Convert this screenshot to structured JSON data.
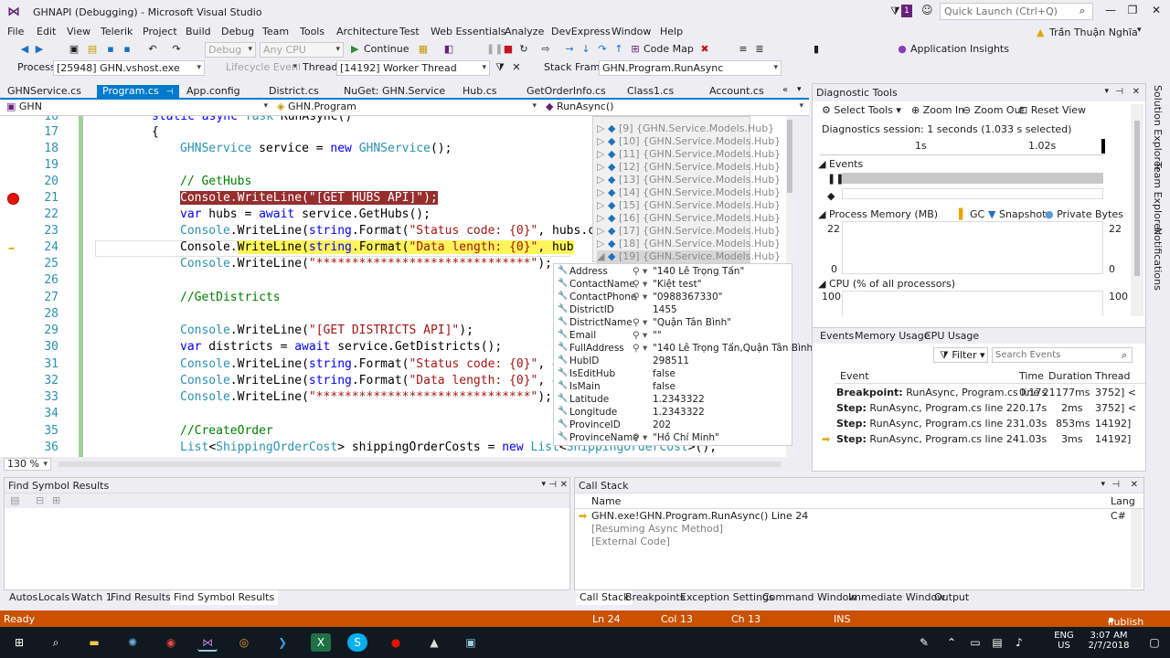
{
  "window": {
    "title": "GHNAPI (Debugging) - Microsoft Visual Studio",
    "quick_launch_placeholder": "Quick Launch (Ctrl+Q)",
    "notification_count": "1"
  },
  "menu": [
    "File",
    "Edit",
    "View",
    "Telerik",
    "Project",
    "Build",
    "Debug",
    "Team",
    "Tools",
    "Architecture",
    "Test",
    "Web Essentials",
    "Analyze",
    "DevExpress",
    "Window",
    "Help"
  ],
  "user": "Trần Thuận Nghĩa",
  "toolbar": {
    "config": "Debug",
    "platform": "Any CPU",
    "continue": "Continue",
    "code_map": "Code Map",
    "app_insights": "Application Insights"
  },
  "debug_location": {
    "process_label": "Process:",
    "process": "[25948] GHN.vshost.exe",
    "lifecycle": "Lifecycle Events",
    "thread_label": "Thread:",
    "thread": "[14192] Worker Thread",
    "frame_label": "Stack Frame:",
    "frame": "GHN.Program.RunAsync"
  },
  "doc_tabs": [
    "GHNService.cs",
    "Program.cs",
    "App.config",
    "District.cs",
    "NuGet: GHN.Service",
    "Hub.cs",
    "GetOrderInfo.cs",
    "Class1.cs",
    "Account.cs"
  ],
  "nav": {
    "project": "GHN",
    "class": "GHN.Program",
    "member": "RunAsync()"
  },
  "code_lines": [
    {
      "n": "16",
      "text": "static async Task RunAsync()"
    },
    {
      "n": "17",
      "text": "{"
    },
    {
      "n": "18",
      "text": "GHNService service = new GHNService();"
    },
    {
      "n": "19",
      "text": ""
    },
    {
      "n": "20",
      "text": "// GetHubs"
    },
    {
      "n": "21",
      "text": "Console.WriteLine(\"[GET HUBS API]\");"
    },
    {
      "n": "22",
      "text": "var hubs = await service.GetHubs();"
    },
    {
      "n": "23",
      "text": "Console.WriteLine(string.Format(\"Status code: {0}\", hubs.c"
    },
    {
      "n": "24",
      "text": "Console.WriteLine(string.Format(\"Data length: {0}\", hub"
    },
    {
      "n": "25",
      "text": "Console.WriteLine(\"******************************\");"
    },
    {
      "n": "26",
      "text": ""
    },
    {
      "n": "27",
      "text": "//GetDistricts"
    },
    {
      "n": "28",
      "text": ""
    },
    {
      "n": "29",
      "text": "Console.WriteLine(\"[GET DISTRICTS API]\");"
    },
    {
      "n": "30",
      "text": "var districts = await service.GetDistricts();"
    },
    {
      "n": "31",
      "text": "Console.WriteLine(string.Format(\"Status code: {0}\", d"
    },
    {
      "n": "32",
      "text": "Console.WriteLine(string.Format(\"Data length: {0}\", d"
    },
    {
      "n": "33",
      "text": "Console.WriteLine(\"******************************\");"
    },
    {
      "n": "34",
      "text": ""
    },
    {
      "n": "35",
      "text": "//CreateOrder"
    },
    {
      "n": "36",
      "text": "List<ShippingOrderCost> shippingOrderCosts = new List<ShippingOrderCost>();"
    }
  ],
  "hub_items": [
    "[9]",
    "[10]",
    "[11]",
    "[12]",
    "[13]",
    "[14]",
    "[15]",
    "[16]",
    "[17]",
    "[18]",
    "[19]"
  ],
  "hub_type": "{GHN.Service.Models.Hub}",
  "hub_props": [
    {
      "name": "Address",
      "value": "\"140 Lê Trọng Tấn\"",
      "str": true
    },
    {
      "name": "ContactName",
      "value": "\"Kiệt test\"",
      "str": true
    },
    {
      "name": "ContactPhone",
      "value": "\"0988367330\"",
      "str": true
    },
    {
      "name": "DistrictID",
      "value": "1455",
      "str": false
    },
    {
      "name": "DistrictName",
      "value": "\"Quận Tân Bình\"",
      "str": true
    },
    {
      "name": "Email",
      "value": "\"\"",
      "str": true
    },
    {
      "name": "FullAddress",
      "value": "\"140 Lê Trọng Tấn,Quận Tân Bình\"",
      "str": true
    },
    {
      "name": "HubID",
      "value": "298511",
      "str": false
    },
    {
      "name": "IsEditHub",
      "value": "false",
      "str": false
    },
    {
      "name": "IsMain",
      "value": "false",
      "str": false
    },
    {
      "name": "Latitude",
      "value": "1.2343322",
      "str": false
    },
    {
      "name": "Longitude",
      "value": "1.2343322",
      "str": false
    },
    {
      "name": "ProvinceID",
      "value": "202",
      "str": false
    },
    {
      "name": "ProvinceName",
      "value": "\"Hồ Chí Minh\"",
      "str": true
    }
  ],
  "zoom": "130 %",
  "diag": {
    "title": "Diagnostic Tools",
    "select_tools": "Select Tools",
    "zoom_in": "Zoom In",
    "zoom_out": "Zoom Out",
    "reset_view": "Reset View",
    "session": "Diagnostics session: 1 seconds (1.033 s selected)",
    "tick1": "1s",
    "tick2": "1.02s",
    "events_section": "Events",
    "memory_section": "Process Memory (MB)",
    "gc": "GC",
    "snapshot": "Snapshot",
    "private_bytes": "Private Bytes",
    "mem_max": "22",
    "mem_min": "0",
    "cpu_section": "CPU (% of all processors)",
    "cpu_max": "100",
    "tabs": [
      "Events",
      "Memory Usage",
      "CPU Usage"
    ],
    "filter": "Filter",
    "search_placeholder": "Search Events",
    "columns": [
      "Event",
      "Time",
      "Duration",
      "Thread"
    ],
    "events": [
      {
        "kind": "Breakpoint:",
        "desc": "RunAsync, Program.cs line 21",
        "time": "0.17s",
        "duration": "177ms",
        "thread": "3752] <"
      },
      {
        "kind": "Step:",
        "desc": "RunAsync, Program.cs line 22",
        "time": "0.17s",
        "duration": "2ms",
        "thread": "3752] <"
      },
      {
        "kind": "Step:",
        "desc": "RunAsync, Program.cs line 23",
        "time": "1.03s",
        "duration": "853ms",
        "thread": "14192]"
      },
      {
        "kind": "Step:",
        "desc": "RunAsync, Program.cs line 24",
        "time": "1.03s",
        "duration": "3ms",
        "thread": "14192]"
      }
    ]
  },
  "side_tabs": [
    "Solution Explorer",
    "Team Explorer",
    "Notifications"
  ],
  "find_symbol": {
    "title": "Find Symbol Results"
  },
  "bottom_left_tabs": [
    "Autos",
    "Locals",
    "Watch 1",
    "Find Results 1",
    "Find Symbol Results"
  ],
  "call_stack": {
    "title": "Call Stack",
    "col_name": "Name",
    "col_lang": "Lang",
    "rows": [
      {
        "name": "GHN.exe!GHN.Program.RunAsync() Line 24",
        "lang": "C#"
      },
      {
        "name": "[Resuming Async Method]",
        "lang": ""
      },
      {
        "name": "[External Code]",
        "lang": ""
      }
    ]
  },
  "bottom_right_tabs": [
    "Call Stack",
    "Breakpoints",
    "Exception Settings",
    "Command Window",
    "Immediate Window",
    "Output"
  ],
  "status": {
    "state": "Ready",
    "ln": "Ln 24",
    "col": "Col 13",
    "ch": "Ch 13",
    "ins": "INS",
    "publish": "Publish"
  },
  "tray": {
    "lang": "ENG",
    "region": "US",
    "time": "3:07 AM",
    "date": "2/7/2018"
  }
}
